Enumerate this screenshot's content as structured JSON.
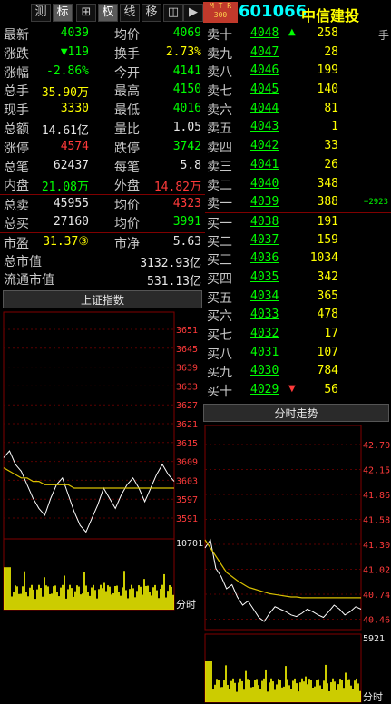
{
  "toolbar": {
    "buttons": [
      {
        "label": "测",
        "active": false
      },
      {
        "label": "标",
        "active": true
      },
      {
        "label": "⊞",
        "active": false
      },
      {
        "label": "权",
        "active": false
      },
      {
        "label": "线",
        "active": false
      },
      {
        "label": "移",
        "active": false
      },
      {
        "label": "◫",
        "active": false
      },
      {
        "label": "▶",
        "active": false
      }
    ],
    "badge_line1": "M T R",
    "badge_line2": "300",
    "code": "601066",
    "name": "中信建投",
    "hand_label": "手"
  },
  "quote": {
    "rows": [
      {
        "l1": "最新",
        "v1": "4039",
        "c1": "green",
        "l2": "均价",
        "v2": "4069",
        "c2": "green"
      },
      {
        "l1": "涨跌",
        "v1": "▼119",
        "c1": "green",
        "l2": "换手",
        "v2": "2.73%",
        "c2": "yellow"
      },
      {
        "l1": "涨幅",
        "v1": "-2.86%",
        "c1": "green",
        "l2": "今开",
        "v2": "4141",
        "c2": "green"
      },
      {
        "l1": "总手",
        "v1": "35.90万",
        "c1": "yellow",
        "l2": "最高",
        "v2": "4150",
        "c2": "green"
      },
      {
        "l1": "现手",
        "v1": "3330",
        "c1": "yellow",
        "l2": "最低",
        "v2": "4016",
        "c2": "green"
      },
      {
        "l1": "总额",
        "v1": "14.61亿",
        "c1": "white",
        "l2": "量比",
        "v2": "1.05",
        "c2": "white"
      },
      {
        "l1": "涨停",
        "v1": "4574",
        "c1": "red",
        "l2": "跌停",
        "v2": "3742",
        "c2": "green"
      },
      {
        "l1": "总笔",
        "v1": "62437",
        "c1": "white",
        "l2": "每笔",
        "v2": "5.8",
        "c2": "white"
      },
      {
        "l1": "内盘",
        "v1": "21.08万",
        "c1": "green",
        "l2": "外盘",
        "v2": "14.82万",
        "c2": "red"
      },
      {
        "l1": "总卖",
        "v1": "45955",
        "c1": "white",
        "l2": "均价",
        "v2": "4323",
        "c2": "red"
      },
      {
        "l1": "总买",
        "v1": "27160",
        "c1": "white",
        "l2": "均价",
        "v2": "3991",
        "c2": "green"
      },
      {
        "l1": "市盈",
        "v1": "31.37③",
        "c1": "yellow",
        "l2": "市净",
        "v2": "5.63",
        "c2": "white"
      },
      {
        "l1": "总市值",
        "v1": "",
        "c1": "white",
        "l2": "",
        "v2": "3132.93亿",
        "c2": "white"
      },
      {
        "l1": "流通市值",
        "v1": "",
        "c1": "white",
        "l2": "",
        "v2": "531.13亿",
        "c2": "white"
      }
    ]
  },
  "order_book": {
    "rows": [
      {
        "label": "卖十",
        "price": "4048",
        "vol": "258",
        "arrow": "up",
        "extra": ""
      },
      {
        "label": "卖九",
        "price": "4047",
        "vol": "28",
        "arrow": "",
        "extra": ""
      },
      {
        "label": "卖八",
        "price": "4046",
        "vol": "199",
        "arrow": "",
        "extra": ""
      },
      {
        "label": "卖七",
        "price": "4045",
        "vol": "140",
        "arrow": "",
        "extra": ""
      },
      {
        "label": "卖六",
        "price": "4044",
        "vol": "81",
        "arrow": "",
        "extra": ""
      },
      {
        "label": "卖五",
        "price": "4043",
        "vol": "1",
        "arrow": "",
        "extra": ""
      },
      {
        "label": "卖四",
        "price": "4042",
        "vol": "33",
        "arrow": "",
        "extra": ""
      },
      {
        "label": "卖三",
        "price": "4041",
        "vol": "26",
        "arrow": "",
        "extra": ""
      },
      {
        "label": "卖二",
        "price": "4040",
        "vol": "348",
        "arrow": "",
        "extra": ""
      },
      {
        "label": "卖一",
        "price": "4039",
        "vol": "388",
        "arrow": "",
        "extra": "−2923"
      },
      {
        "label": "买一",
        "price": "4038",
        "vol": "191",
        "arrow": "",
        "extra": ""
      },
      {
        "label": "买二",
        "price": "4037",
        "vol": "159",
        "arrow": "",
        "extra": ""
      },
      {
        "label": "买三",
        "price": "4036",
        "vol": "1034",
        "arrow": "",
        "extra": ""
      },
      {
        "label": "买四",
        "price": "4035",
        "vol": "342",
        "arrow": "",
        "extra": ""
      },
      {
        "label": "买五",
        "price": "4034",
        "vol": "365",
        "arrow": "",
        "extra": ""
      },
      {
        "label": "买六",
        "price": "4033",
        "vol": "478",
        "arrow": "",
        "extra": ""
      },
      {
        "label": "买七",
        "price": "4032",
        "vol": "17",
        "arrow": "",
        "extra": ""
      },
      {
        "label": "买八",
        "price": "4031",
        "vol": "107",
        "arrow": "",
        "extra": ""
      },
      {
        "label": "买九",
        "price": "4030",
        "vol": "784",
        "arrow": "",
        "extra": ""
      },
      {
        "label": "买十",
        "price": "4029",
        "vol": "56",
        "arrow": "down",
        "extra": ""
      }
    ]
  },
  "index_chart": {
    "title": "上证指数",
    "price_ticks": [
      "3651",
      "3645",
      "3639",
      "3633",
      "3627",
      "3621",
      "3615",
      "3609",
      "3603",
      "3597",
      "3591"
    ],
    "vol_label": "10701",
    "time_label": "分时"
  },
  "stock_chart": {
    "title": "分时走势",
    "price_ticks": [
      "42.70",
      "42.15",
      "41.86",
      "41.58",
      "41.30",
      "41.02",
      "40.74",
      "40.46"
    ],
    "vol_label": "5921",
    "time_label": "分时"
  },
  "chart_data": [
    {
      "type": "line",
      "title": "上证指数",
      "ylim": [
        3588,
        3655
      ],
      "series": [
        {
          "values": [
            3612,
            3614,
            3610,
            3608,
            3604,
            3600,
            3597,
            3595,
            3600,
            3604,
            3606,
            3601,
            3596,
            3592,
            3590,
            3594,
            3598,
            3603,
            3600,
            3597,
            3601,
            3604,
            3606,
            3603,
            3599,
            3603,
            3607,
            3610,
            3607,
            3605
          ]
        },
        {
          "values": [
            3609,
            3608,
            3607,
            3606,
            3606,
            3605,
            3605,
            3604,
            3604,
            3604,
            3604,
            3604,
            3603,
            3603,
            3603,
            3603,
            3603,
            3603,
            3603,
            3603,
            3603,
            3603,
            3603,
            3603,
            3603,
            3603,
            3603,
            3603,
            3603,
            3603
          ]
        }
      ]
    },
    {
      "type": "line",
      "title": "分时走势",
      "ylim": [
        40.3,
        42.8
      ],
      "series": [
        {
          "values": [
            41.3,
            41.4,
            41.05,
            40.95,
            40.8,
            40.85,
            40.7,
            40.6,
            40.65,
            40.55,
            40.45,
            40.4,
            40.5,
            40.58,
            40.55,
            40.52,
            40.48,
            40.46,
            40.5,
            40.55,
            40.52,
            40.48,
            40.45,
            40.52,
            40.6,
            40.55,
            40.48,
            40.52,
            40.58,
            40.55
          ]
        },
        {
          "values": [
            41.4,
            41.3,
            41.2,
            41.1,
            41.0,
            40.95,
            40.9,
            40.86,
            40.82,
            40.8,
            40.78,
            40.76,
            40.74,
            40.73,
            40.72,
            40.71,
            40.7,
            40.7,
            40.69,
            40.69,
            40.69,
            40.69,
            40.69,
            40.69,
            40.69,
            40.69,
            40.69,
            40.69,
            40.69,
            40.69
          ]
        }
      ]
    }
  ]
}
